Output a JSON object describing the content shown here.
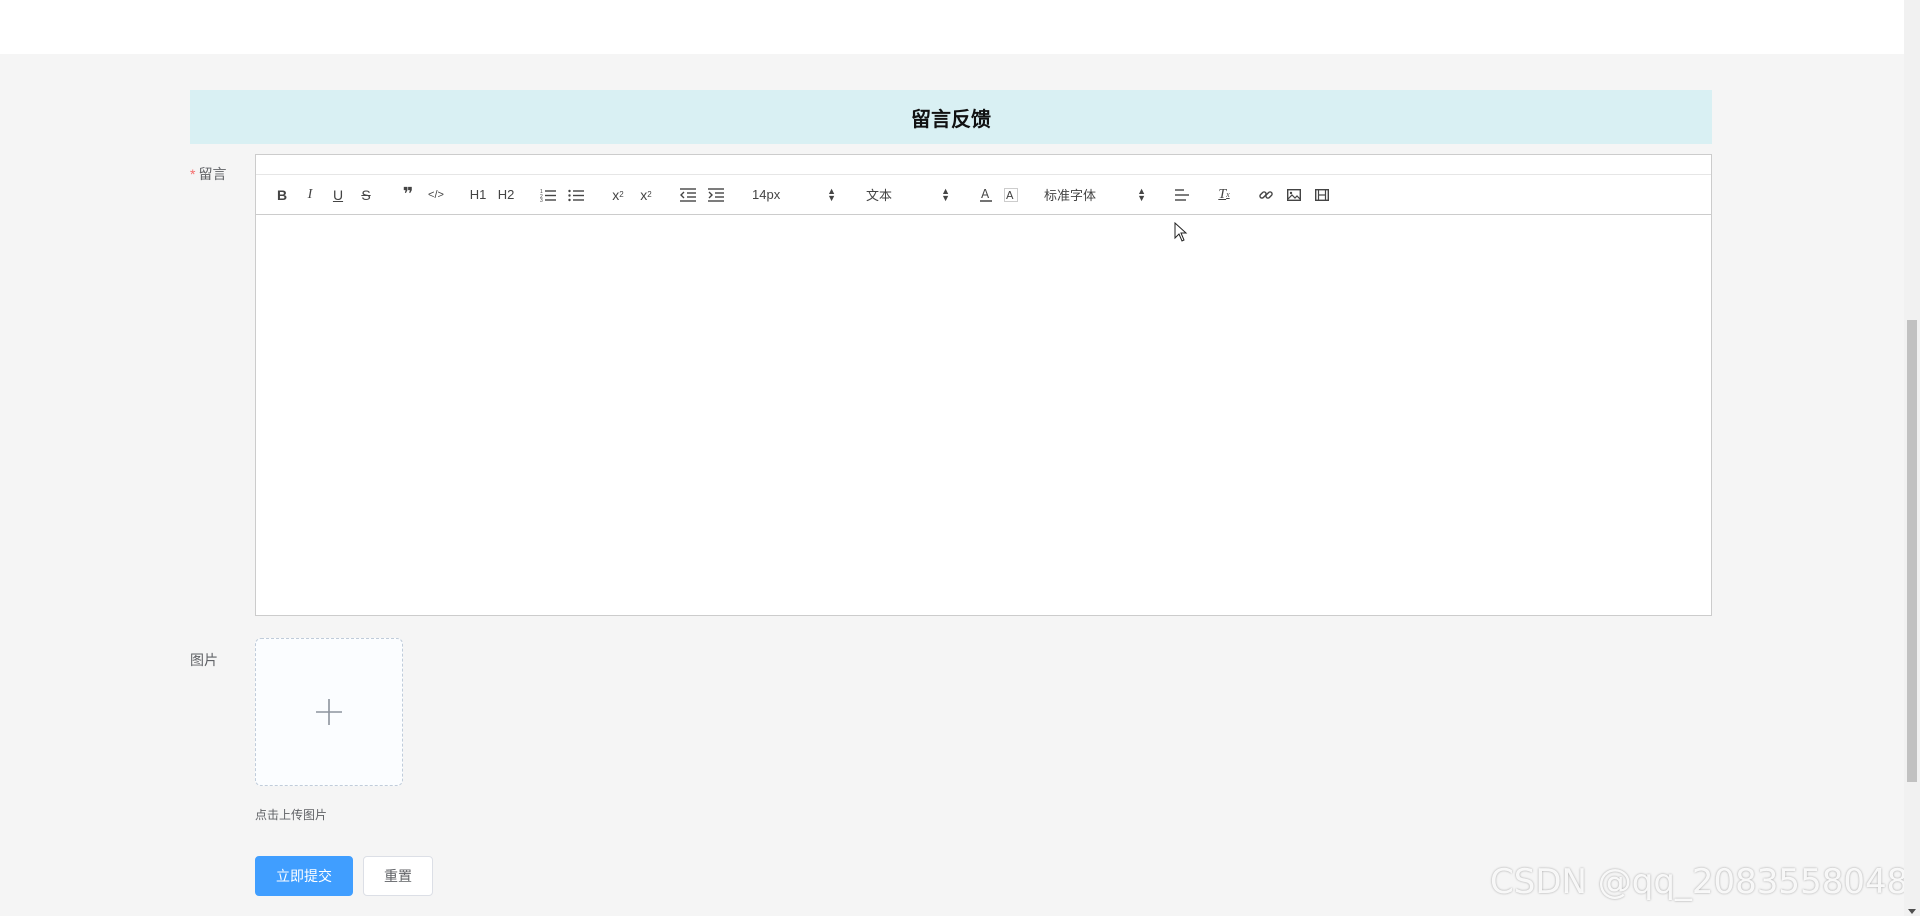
{
  "page": {
    "title": "留言反馈"
  },
  "form": {
    "message_label": "留言",
    "required_mark": "*",
    "image_label": "图片",
    "upload_tip": "点击上传图片",
    "submit_label": "立即提交",
    "reset_label": "重置"
  },
  "toolbar": {
    "h1_label": "H1",
    "h2_label": "H2",
    "size_select": "14px",
    "header_select": "文本",
    "font_select": "标准字体"
  },
  "icons": [
    "bold-icon",
    "italic-icon",
    "underline-icon",
    "strike-icon",
    "blockquote-icon",
    "code-block-icon",
    "ordered-list-icon",
    "bullet-list-icon",
    "subscript-icon",
    "superscript-icon",
    "outdent-icon",
    "indent-icon",
    "text-color-icon",
    "background-color-icon",
    "align-icon",
    "clean-format-icon",
    "link-icon",
    "image-icon",
    "video-icon",
    "plus-icon"
  ],
  "watermark": "CSDN @qq_2083558048",
  "colors": {
    "title_bg": "#d9f0f3",
    "primary": "#409eff",
    "required": "#f56c6c"
  }
}
